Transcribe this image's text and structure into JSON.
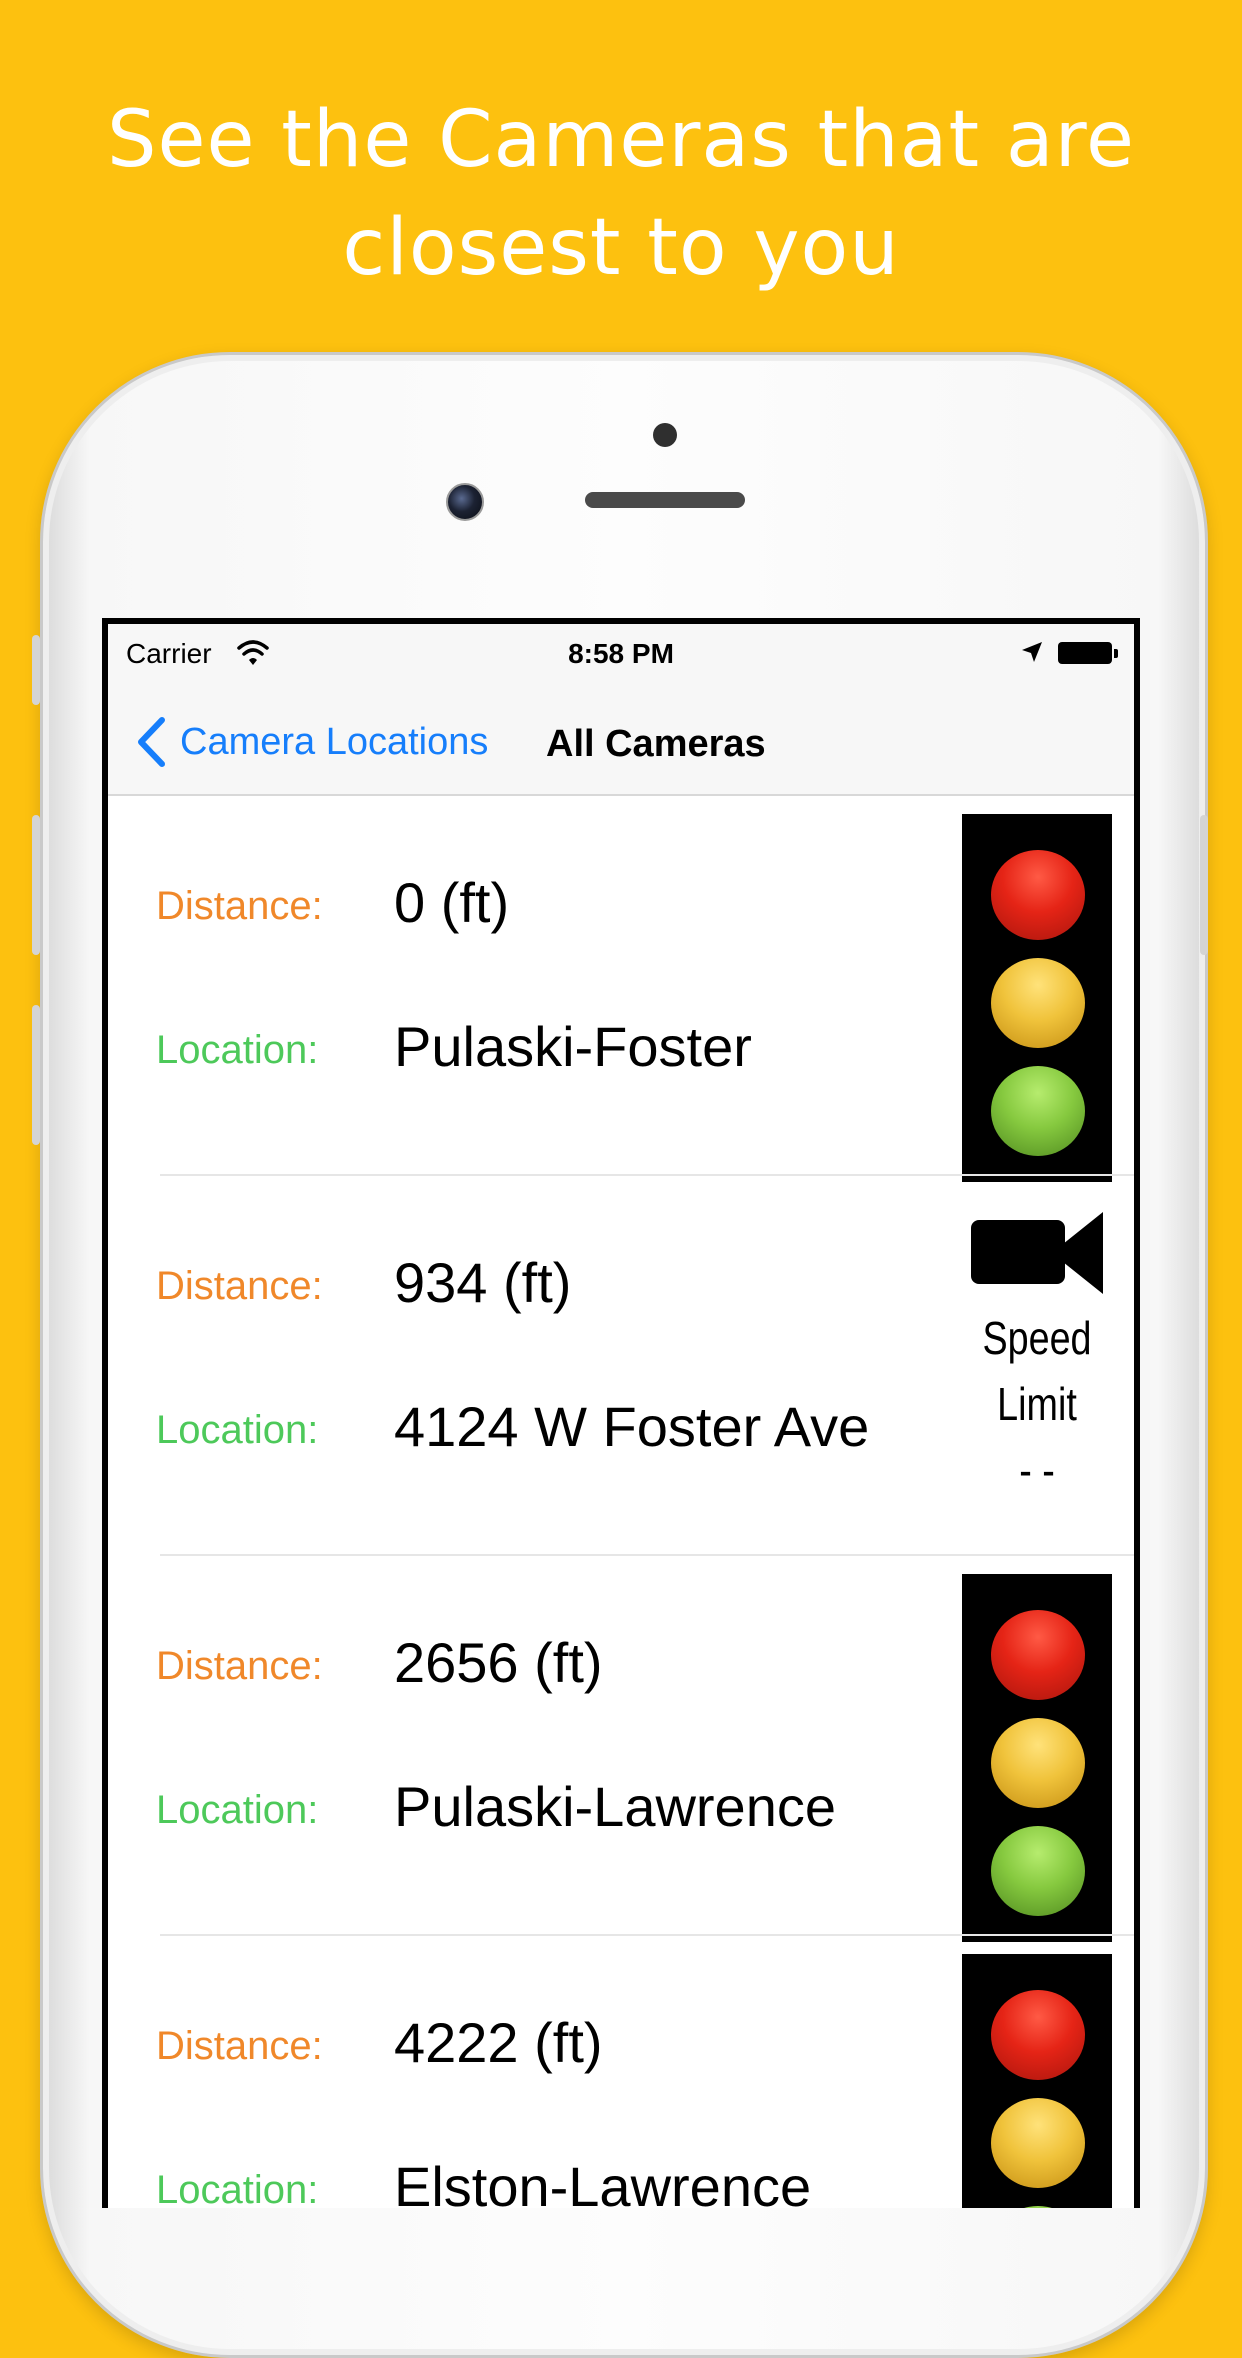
{
  "headline": {
    "line1": "See the Cameras that are",
    "line2": "closest to you"
  },
  "status_bar": {
    "carrier": "Carrier",
    "time": "8:58 PM"
  },
  "nav": {
    "back_label": "Camera Locations",
    "title": "All Cameras"
  },
  "labels": {
    "distance": "Distance:",
    "location": "Location:"
  },
  "cameras": [
    {
      "distance": "0 (ft)",
      "location": "Pulaski-Foster",
      "icon": "traffic-light-icon"
    },
    {
      "distance": "934 (ft)",
      "location": "4124 W Foster Ave",
      "icon": "video-camera-icon",
      "speed_text_1": "Speed",
      "speed_text_2": "Limit",
      "speed_value": "- -"
    },
    {
      "distance": "2656 (ft)",
      "location": "Pulaski-Lawrence",
      "icon": "traffic-light-icon"
    },
    {
      "distance": "4222 (ft)",
      "location": "Elston-Lawrence",
      "icon": "traffic-light-icon"
    }
  ],
  "colors": {
    "background": "#FDC10F",
    "distance_label": "#f0882a",
    "location_label": "#4dc95a",
    "link": "#167efb"
  }
}
